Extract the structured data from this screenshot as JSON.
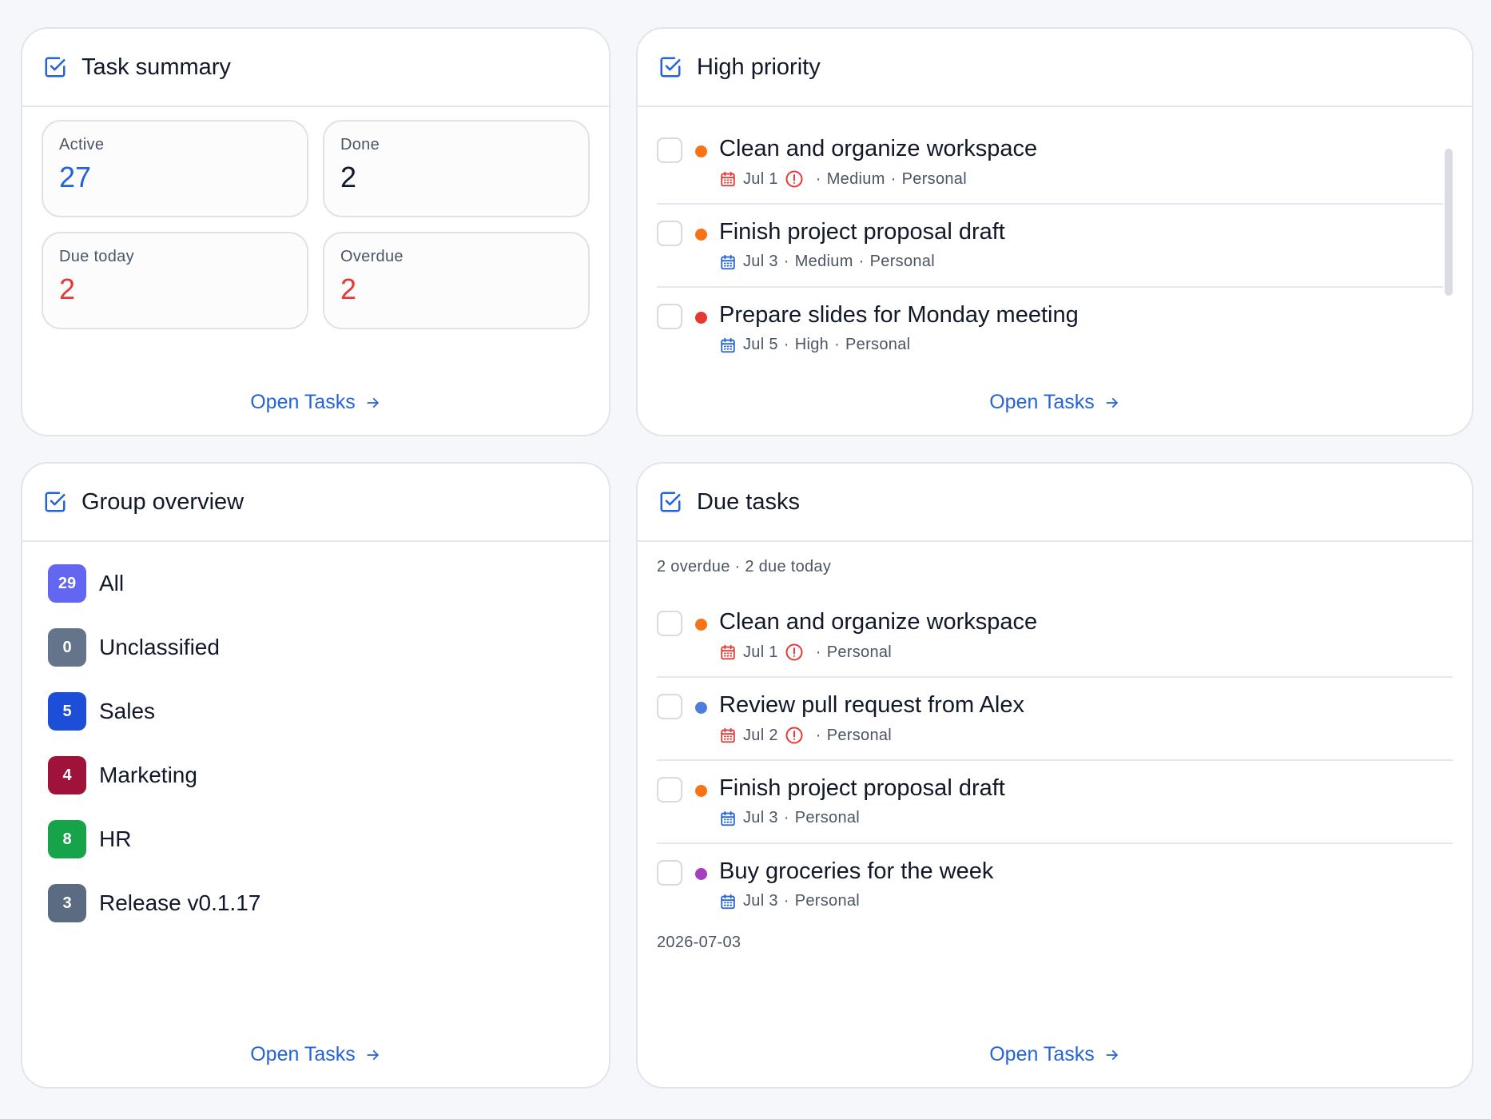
{
  "summary": {
    "title": "Task summary",
    "stats": [
      {
        "label": "Active",
        "value": "27",
        "color": "#2563d8"
      },
      {
        "label": "Done",
        "value": "2",
        "color": "#111827"
      },
      {
        "label": "Due today",
        "value": "2",
        "color": "#e53935"
      },
      {
        "label": "Overdue",
        "value": "2",
        "color": "#e53935"
      }
    ],
    "link": "Open Tasks"
  },
  "priority": {
    "title": "High priority",
    "tasks": [
      {
        "title": "Clean and organize workspace",
        "dot": "#f97316",
        "date": "Jul 1",
        "overdue": true,
        "priority": "Medium",
        "group": "Personal"
      },
      {
        "title": "Finish project proposal draft",
        "dot": "#f97316",
        "date": "Jul 3",
        "overdue": false,
        "priority": "Medium",
        "group": "Personal"
      },
      {
        "title": "Prepare slides for Monday meeting",
        "dot": "#e53935",
        "date": "Jul 5",
        "overdue": false,
        "priority": "High",
        "group": "Personal"
      }
    ],
    "link": "Open Tasks"
  },
  "groups": {
    "title": "Group overview",
    "items": [
      {
        "count": "29",
        "name": "All",
        "color": "#6366f1"
      },
      {
        "count": "0",
        "name": "Unclassified",
        "color": "#64748b"
      },
      {
        "count": "5",
        "name": "Sales",
        "color": "#1d4ed8"
      },
      {
        "count": "4",
        "name": "Marketing",
        "color": "#9f1239"
      },
      {
        "count": "8",
        "name": "HR",
        "color": "#16a34a"
      },
      {
        "count": "3",
        "name": "Release v0.1.17",
        "color": "#5b6b82"
      }
    ],
    "link": "Open Tasks"
  },
  "due": {
    "title": "Due tasks",
    "subtitle": "2 overdue · 2 due today",
    "tasks": [
      {
        "title": "Clean and organize workspace",
        "dot": "#f97316",
        "date": "Jul 1",
        "overdue": true,
        "group": "Personal"
      },
      {
        "title": "Review pull request from Alex",
        "dot": "#4f7ddb",
        "date": "Jul 2",
        "overdue": true,
        "group": "Personal"
      },
      {
        "title": "Finish project proposal draft",
        "dot": "#f97316",
        "date": "Jul 3",
        "overdue": false,
        "group": "Personal"
      },
      {
        "title": "Buy groceries for the week",
        "dot": "#a63fbf",
        "date": "Jul 3",
        "overdue": false,
        "group": "Personal"
      }
    ],
    "date_footer": "2026-07-03",
    "link": "Open Tasks"
  },
  "separator": "·",
  "icons": {
    "header": "checkbox-check-icon",
    "calendar": "calendar-icon",
    "alert": "alert-circle-icon",
    "arrow": "arrow-right-icon"
  }
}
